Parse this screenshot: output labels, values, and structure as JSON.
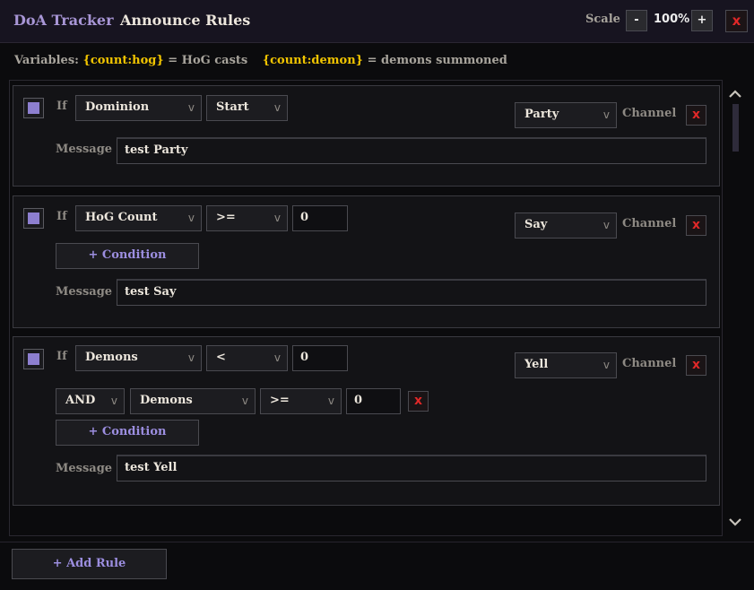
{
  "header": {
    "app_name": "DoA Tracker",
    "title": "Announce Rules",
    "scale_label": "Scale",
    "scale_minus": "-",
    "scale_value": "100%",
    "scale_plus": "+",
    "close": "x"
  },
  "variables": {
    "label": "Variables:",
    "hog_token": "{count:hog}",
    "hog_desc": "= HoG casts",
    "demon_token": "{count:demon}",
    "demon_desc": "= demons summoned"
  },
  "common": {
    "if_label": "If",
    "channel_label": "Channel",
    "message_label": "Message",
    "remove": "x",
    "add_condition": "+ Condition",
    "chevron": "v"
  },
  "rules": [
    {
      "enabled": true,
      "condition": {
        "subject": "Dominion",
        "operator": "Start"
      },
      "channel": "Party",
      "message": "test Party"
    },
    {
      "enabled": true,
      "condition": {
        "subject": "HoG Count",
        "operator": ">=",
        "value": "0"
      },
      "channel": "Say",
      "message": "test Say"
    },
    {
      "enabled": true,
      "condition": {
        "subject": "Demons",
        "operator": "<",
        "value": "0"
      },
      "extra_condition": {
        "joiner": "AND",
        "subject": "Demons",
        "operator": ">=",
        "value": "0"
      },
      "channel": "Yell",
      "message": "test Yell"
    }
  ],
  "footer": {
    "add_rule": "+ Add Rule"
  },
  "colors": {
    "accent": "#8d7fd0",
    "token": "#f0c400",
    "danger": "#e02828"
  }
}
